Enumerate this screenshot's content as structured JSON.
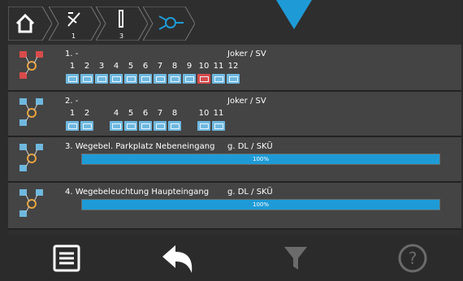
{
  "breadcrumb": {
    "items": [
      {
        "icon": "home-icon"
      },
      {
        "icon": "scissor-icon",
        "num": "1"
      },
      {
        "icon": "bar-icon",
        "num": "3"
      },
      {
        "icon": "network-icon"
      }
    ]
  },
  "rows": [
    {
      "type": "numbers",
      "title": "1. -",
      "right": "Joker / SV",
      "numbers": [
        "1",
        "2",
        "3",
        "4",
        "5",
        "6",
        "7",
        "8",
        "9",
        "10",
        "11",
        "12"
      ],
      "boxes": [
        "blue",
        "blue",
        "blue",
        "blue",
        "blue",
        "blue",
        "blue",
        "blue",
        "blue",
        "red",
        "blue",
        "blue"
      ]
    },
    {
      "type": "numbers",
      "title": "2. -",
      "right": "Joker / SV",
      "numbers": [
        "1",
        "2",
        "",
        "4",
        "5",
        "6",
        "7",
        "8",
        "",
        "10",
        "11",
        ""
      ],
      "boxes": [
        "blue",
        "blue",
        "",
        "blue",
        "blue",
        "blue",
        "blue",
        "blue",
        "",
        "blue",
        "blue",
        ""
      ]
    },
    {
      "type": "bar",
      "title": "3. Wegebel. Parkplatz Nebeneingang",
      "right": "g. DL / SKÜ",
      "progress": "100%"
    },
    {
      "type": "bar",
      "title": "4. Wegebeleuchtung Haupteingang",
      "right": "g. DL / SKÜ",
      "progress": "100%"
    }
  ],
  "toolbar": {
    "icons": [
      "list-icon",
      "back-icon",
      "filter-icon",
      "help-icon"
    ]
  },
  "colors": {
    "accent": "#1e9bd7",
    "panel": "#444444",
    "bg": "#2e2e2e"
  }
}
